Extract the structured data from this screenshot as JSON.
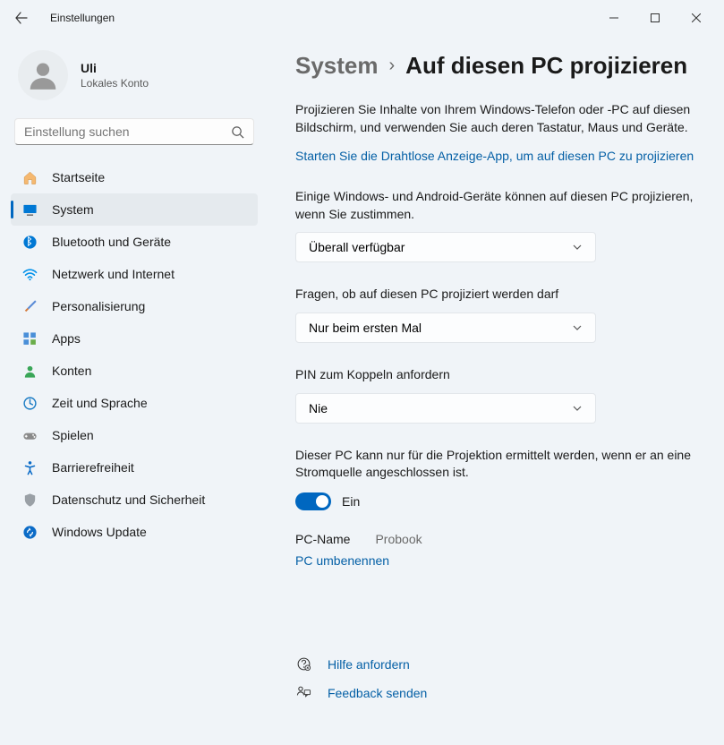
{
  "window": {
    "title": "Einstellungen"
  },
  "user": {
    "name": "Uli",
    "account_type": "Lokales Konto"
  },
  "search": {
    "placeholder": "Einstellung suchen"
  },
  "nav": {
    "items": [
      {
        "label": "Startseite"
      },
      {
        "label": "System"
      },
      {
        "label": "Bluetooth und Geräte"
      },
      {
        "label": "Netzwerk und Internet"
      },
      {
        "label": "Personalisierung"
      },
      {
        "label": "Apps"
      },
      {
        "label": "Konten"
      },
      {
        "label": "Zeit und Sprache"
      },
      {
        "label": "Spielen"
      },
      {
        "label": "Barrierefreiheit"
      },
      {
        "label": "Datenschutz und Sicherheit"
      },
      {
        "label": "Windows Update"
      }
    ]
  },
  "header": {
    "parent": "System",
    "current": "Auf diesen PC projizieren"
  },
  "main": {
    "description": "Projizieren Sie Inhalte von Ihrem Windows-Telefon oder -PC auf diesen Bildschirm, und verwenden Sie auch deren Tastatur, Maus und Geräte.",
    "app_link": "Starten Sie die Drahtlose Anzeige-App, um auf diesen PC zu projizieren",
    "setting1_label": "Einige Windows- und Android-Geräte können auf diesen PC projizieren, wenn Sie zustimmen.",
    "setting1_value": "Überall verfügbar",
    "setting2_label": "Fragen, ob auf diesen PC projiziert werden darf",
    "setting2_value": "Nur beim ersten Mal",
    "setting3_label": "PIN zum Koppeln anfordern",
    "setting3_value": "Nie",
    "setting4_label": "Dieser PC kann nur für die Projektion ermittelt werden, wenn er an eine Stromquelle angeschlossen ist.",
    "toggle_state": "Ein",
    "pc_name_label": "PC-Name",
    "pc_name_value": "Probook",
    "rename_link": "PC umbenennen",
    "help_link": "Hilfe anfordern",
    "feedback_link": "Feedback senden"
  }
}
